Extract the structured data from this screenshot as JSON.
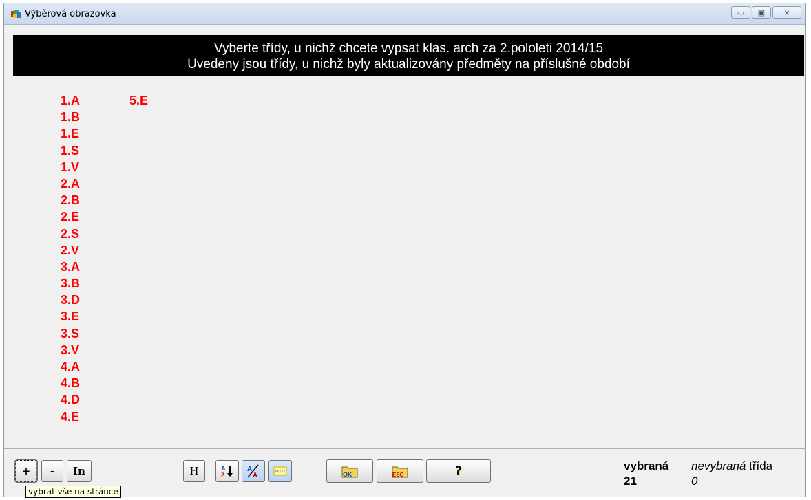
{
  "window": {
    "title": "Výběrová obrazovka",
    "buttons": {
      "minimize": "▭",
      "maximize": "▣",
      "close": "⨯"
    }
  },
  "header": {
    "line1": "Vyberte třídy, u nichž chcete vypsat klas. arch za 2.pololeti 2014/15",
    "line2": "Uvedeny jsou třídy, u nichž byly aktualizovány předměty na příslušné období"
  },
  "classes": {
    "column1": [
      "1.A",
      "1.B",
      "1.E",
      "1.S",
      "1.V",
      "2.A",
      "2.B",
      "2.E",
      "2.S",
      "2.V",
      "3.A",
      "3.B",
      "3.D",
      "3.E",
      "3.S",
      "3.V",
      "4.A",
      "4.B",
      "4.D",
      "4.E"
    ],
    "column2": [
      "5.E"
    ]
  },
  "toolbar": {
    "plus": "+",
    "minus": "-",
    "invert": "In",
    "h": "H",
    "ok": "OK",
    "esc": "ESC",
    "help": "?"
  },
  "status": {
    "selected_label": "vybraná",
    "selected_count": "21",
    "unselected_label": "nevybraná",
    "class_word": "třída",
    "unselected_count": "0"
  },
  "tooltip": "vybrat vše  na stránce",
  "colors": {
    "class_text": "#ff0000",
    "header_bg": "#000000"
  }
}
